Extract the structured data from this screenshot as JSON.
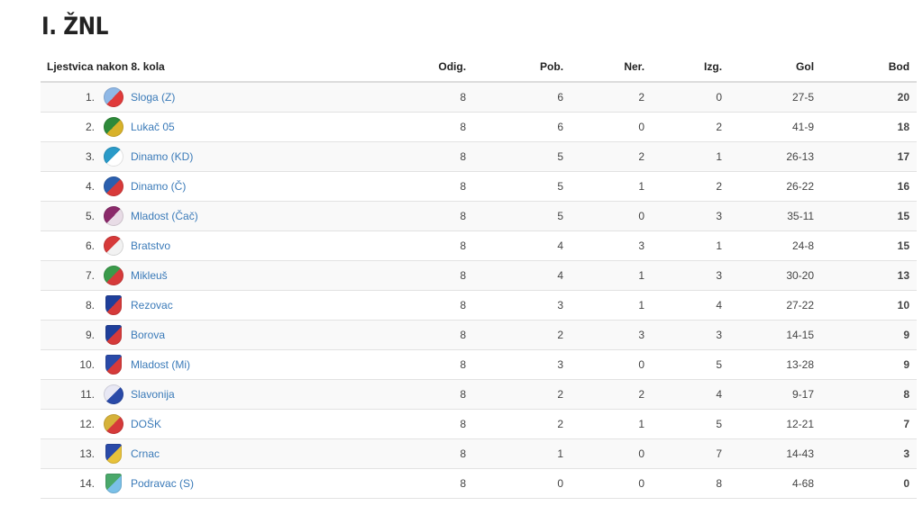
{
  "title": "I. ŽNL",
  "header": {
    "label": "Ljestvica nakon 8. kola",
    "played": "Odig.",
    "won": "Pob.",
    "drawn": "Ner.",
    "lost": "Izg.",
    "goals": "Gol",
    "points": "Bod"
  },
  "rows": [
    {
      "pos": "1.",
      "team": "Sloga (Z)",
      "played": "8",
      "won": "6",
      "drawn": "2",
      "lost": "0",
      "goals": "27-5",
      "points": "20",
      "crest_colors": [
        "#8fb8e6",
        "#e03a3a"
      ]
    },
    {
      "pos": "2.",
      "team": "Lukač 05",
      "played": "8",
      "won": "6",
      "drawn": "0",
      "lost": "2",
      "goals": "41-9",
      "points": "18",
      "crest_colors": [
        "#2e8a3a",
        "#d8b22a"
      ]
    },
    {
      "pos": "3.",
      "team": "Dinamo (KD)",
      "played": "8",
      "won": "5",
      "drawn": "2",
      "lost": "1",
      "goals": "26-13",
      "points": "17",
      "crest_colors": [
        "#2a9ac8",
        "#ffffff"
      ]
    },
    {
      "pos": "4.",
      "team": "Dinamo (Č)",
      "played": "8",
      "won": "5",
      "drawn": "1",
      "lost": "2",
      "goals": "26-22",
      "points": "16",
      "crest_colors": [
        "#2b5fae",
        "#d83a3a"
      ]
    },
    {
      "pos": "5.",
      "team": "Mladost (Čač)",
      "played": "8",
      "won": "5",
      "drawn": "0",
      "lost": "3",
      "goals": "35-11",
      "points": "15",
      "crest_colors": [
        "#8a2a6a",
        "#e8dce6"
      ]
    },
    {
      "pos": "6.",
      "team": "Bratstvo",
      "played": "8",
      "won": "4",
      "drawn": "3",
      "lost": "1",
      "goals": "24-8",
      "points": "15",
      "crest_colors": [
        "#d63a3a",
        "#f2f2f2"
      ]
    },
    {
      "pos": "7.",
      "team": "Mikleuš",
      "played": "8",
      "won": "4",
      "drawn": "1",
      "lost": "3",
      "goals": "30-20",
      "points": "13",
      "crest_colors": [
        "#3a9a4a",
        "#d63a3a"
      ]
    },
    {
      "pos": "8.",
      "team": "Rezovac",
      "played": "8",
      "won": "3",
      "drawn": "1",
      "lost": "4",
      "goals": "27-22",
      "points": "10",
      "crest_colors": [
        "#1f3f9a",
        "#d63a3a"
      ]
    },
    {
      "pos": "9.",
      "team": "Borova",
      "played": "8",
      "won": "2",
      "drawn": "3",
      "lost": "3",
      "goals": "14-15",
      "points": "9",
      "crest_colors": [
        "#1f3f9a",
        "#d63a3a"
      ]
    },
    {
      "pos": "10.",
      "team": "Mladost (Mi)",
      "played": "8",
      "won": "3",
      "drawn": "0",
      "lost": "5",
      "goals": "13-28",
      "points": "9",
      "crest_colors": [
        "#2a4aa8",
        "#d63a3a"
      ]
    },
    {
      "pos": "11.",
      "team": "Slavonija",
      "played": "8",
      "won": "2",
      "drawn": "2",
      "lost": "4",
      "goals": "9-17",
      "points": "8",
      "crest_colors": [
        "#e8e8f4",
        "#2a4aa8"
      ]
    },
    {
      "pos": "12.",
      "team": "DOŠK",
      "played": "8",
      "won": "2",
      "drawn": "1",
      "lost": "5",
      "goals": "12-21",
      "points": "7",
      "crest_colors": [
        "#d6b23a",
        "#d63a3a"
      ]
    },
    {
      "pos": "13.",
      "team": "Crnac",
      "played": "8",
      "won": "1",
      "drawn": "0",
      "lost": "7",
      "goals": "14-43",
      "points": "3",
      "crest_colors": [
        "#2a4aa8",
        "#e8c23a"
      ]
    },
    {
      "pos": "14.",
      "team": "Podravac (S)",
      "played": "8",
      "won": "0",
      "drawn": "0",
      "lost": "8",
      "goals": "4-68",
      "points": "0",
      "crest_colors": [
        "#4aa86a",
        "#7ac0e8"
      ]
    }
  ]
}
